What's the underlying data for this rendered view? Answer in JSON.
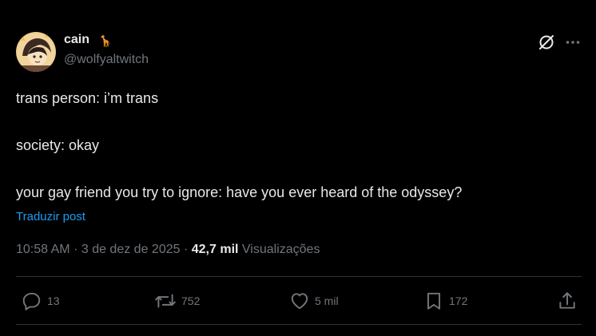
{
  "post": {
    "author": {
      "display_name": "cain",
      "name_emoji": "🦒",
      "handle": "@wolfyaltwitch"
    },
    "text_lines": [
      "trans person: i’m trans",
      "society: okay",
      "your gay friend you try to ignore: have you ever heard of the odyssey?"
    ],
    "translate_label": "Traduzir post",
    "meta": {
      "time": "10:58 AM",
      "separator": "·",
      "date": "3 de dez de 2025",
      "views_count": "42,7 mil",
      "views_label": "Visualizações"
    },
    "actions": {
      "replies": "13",
      "reposts": "752",
      "likes": "5 mil",
      "bookmarks": "172"
    },
    "icons": {
      "header": [
        "grok-icon",
        "more-icon"
      ],
      "actions": [
        "reply-icon",
        "repost-icon",
        "like-icon",
        "bookmark-icon",
        "share-icon"
      ]
    },
    "colors": {
      "background": "#000000",
      "text": "#e7e9ea",
      "muted": "#71767b",
      "link": "#1d9bf0",
      "divider": "#2f3336"
    }
  }
}
